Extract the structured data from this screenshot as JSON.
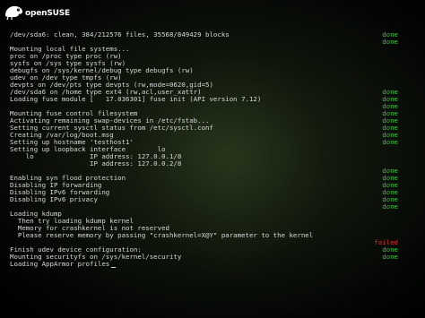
{
  "branding": {
    "logo_text": "openSUSE"
  },
  "colors": {
    "text": "#d8d8d8",
    "done": "#3ac43a",
    "failed": "#e02828",
    "background": "#0f150b"
  },
  "console": {
    "lines": [
      {
        "text": "/dev/sda6: clean, 384/212576 files, 35568/849429 blocks",
        "status": "done"
      },
      {
        "text": "",
        "status": "done"
      },
      {
        "text": "Mounting local file systems...",
        "status": ""
      },
      {
        "text": "proc on /proc type proc (rw)",
        "status": ""
      },
      {
        "text": "sysfs on /sys type sysfs (rw)",
        "status": ""
      },
      {
        "text": "debugfs on /sys/kernel/debug type debugfs (rw)",
        "status": ""
      },
      {
        "text": "udev on /dev type tmpfs (rw)",
        "status": ""
      },
      {
        "text": "devpts on /dev/pts type devpts (rw,mode=0620,gid=5)",
        "status": ""
      },
      {
        "text": "/dev/sda6 on /home type ext4 (rw,acl,user_xattr)",
        "status": "done"
      },
      {
        "text": "Loading fuse module [   17.036301] fuse init (API version 7.12)",
        "status": "done"
      },
      {
        "text": "",
        "status": "done"
      },
      {
        "text": "Mounting fuse control filesystem",
        "status": "done"
      },
      {
        "text": "Activating remaining swap-devices in /etc/fstab...",
        "status": "done"
      },
      {
        "text": "Setting current sysctl status from /etc/sysctl.conf",
        "status": "done"
      },
      {
        "text": "Creating /var/log/boot.msg",
        "status": "done"
      },
      {
        "text": "Setting up hostname 'testhost1'",
        "status": "done"
      },
      {
        "text": "Setting up loopback interface        lo",
        "status": ""
      },
      {
        "text": "    lo              IP address: 127.0.0.1/8",
        "status": ""
      },
      {
        "text": "                    IP address: 127.0.0.2/8",
        "status": ""
      },
      {
        "text": "",
        "status": "done"
      },
      {
        "text": "Enabling syn flood protection",
        "status": "done"
      },
      {
        "text": "Disabling IP forwarding",
        "status": "done"
      },
      {
        "text": "Disabling IPv6 forwarding",
        "status": "done"
      },
      {
        "text": "Disabling IPv6 privacy",
        "status": "done"
      },
      {
        "text": "",
        "status": "done"
      },
      {
        "text": "Loading kdump",
        "status": ""
      },
      {
        "text": "  Then try loading kdump kernel",
        "status": ""
      },
      {
        "text": "  Memory for crashkernel is not reserved",
        "status": ""
      },
      {
        "text": "  Please reserve memory by passing \"crashkernel=X@Y\" parameter to the kernel",
        "status": ""
      },
      {
        "text": "",
        "status": "failed"
      },
      {
        "text": "Finish udev device configuration:",
        "status": "done"
      },
      {
        "text": "Mounting securityfs on /sys/kernel/security",
        "status": "done"
      },
      {
        "text": "Loading AppArmor profiles",
        "status": "",
        "cursor": true
      }
    ]
  }
}
